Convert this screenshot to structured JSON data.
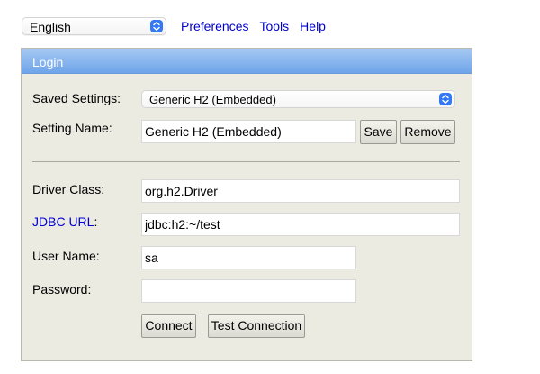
{
  "top_bar": {
    "language_selected": "English",
    "links": {
      "preferences": "Preferences",
      "tools": "Tools",
      "help": "Help"
    }
  },
  "login": {
    "header": "Login",
    "saved_settings": {
      "label": "Saved Settings:",
      "selected": "Generic H2 (Embedded)"
    },
    "setting_name": {
      "label": "Setting Name:",
      "value": "Generic H2 (Embedded)"
    },
    "buttons": {
      "save": "Save",
      "remove": "Remove",
      "connect": "Connect",
      "test_connection": "Test Connection"
    },
    "driver_class": {
      "label": "Driver Class:",
      "value": "org.h2.Driver"
    },
    "jdbc_url": {
      "label": "JDBC URL",
      "suffix": ":",
      "value": "jdbc:h2:~/test"
    },
    "user_name": {
      "label": "User Name:",
      "value": "sa"
    },
    "password": {
      "label": "Password:",
      "value": ""
    }
  },
  "colors": {
    "link": "#0000cc",
    "panel_background": "#ecebe2",
    "header_gradient_top": "#a6c9f2",
    "header_gradient_bottom": "#6ea4ea",
    "select_arrow_accent": "#3478f6"
  }
}
